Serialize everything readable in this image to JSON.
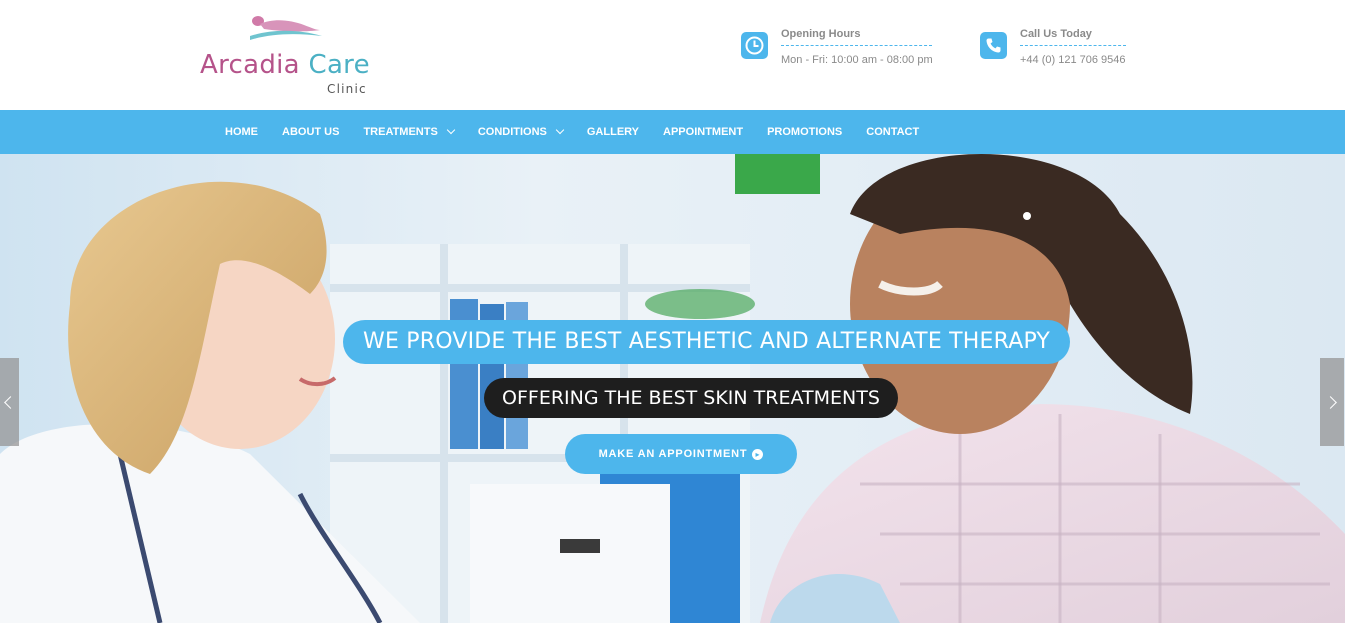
{
  "brand": {
    "name_part1": "Arcadia",
    "name_part2": "Care",
    "subtitle": "Clinic",
    "logo_icon": "reclining-figure-icon"
  },
  "header": {
    "hours": {
      "icon": "clock-icon",
      "title": "Opening Hours",
      "value": "Mon - Fri: 10:00 am - 08:00 pm"
    },
    "call": {
      "icon": "phone-icon",
      "title": "Call Us Today",
      "value": "+44 (0) 121 706 9546"
    }
  },
  "nav": {
    "items": [
      {
        "label": "HOME",
        "dropdown": false
      },
      {
        "label": "ABOUT US",
        "dropdown": false
      },
      {
        "label": "TREATMENTS",
        "dropdown": true
      },
      {
        "label": "CONDITIONS",
        "dropdown": true
      },
      {
        "label": "GALLERY",
        "dropdown": false
      },
      {
        "label": "APPOINTMENT",
        "dropdown": false
      },
      {
        "label": "PROMOTIONS",
        "dropdown": false
      },
      {
        "label": "CONTACT",
        "dropdown": false
      }
    ]
  },
  "hero": {
    "headline": "WE PROVIDE THE BEST AESTHETIC AND ALTERNATE THERAPY",
    "subheadline": "OFFERING THE BEST SKIN TREATMENTS",
    "cta_label": "MAKE AN APPOINTMENT",
    "cta_icon": "arrow-circle-right-icon",
    "prev_icon": "chevron-left-icon",
    "next_icon": "chevron-right-icon"
  },
  "colors": {
    "accent": "#4db6ec",
    "brand_pink": "#b5538a",
    "brand_teal": "#4bb0c4",
    "dark_caption": "#1e1e1e",
    "muted_text": "#8a8a8a"
  }
}
